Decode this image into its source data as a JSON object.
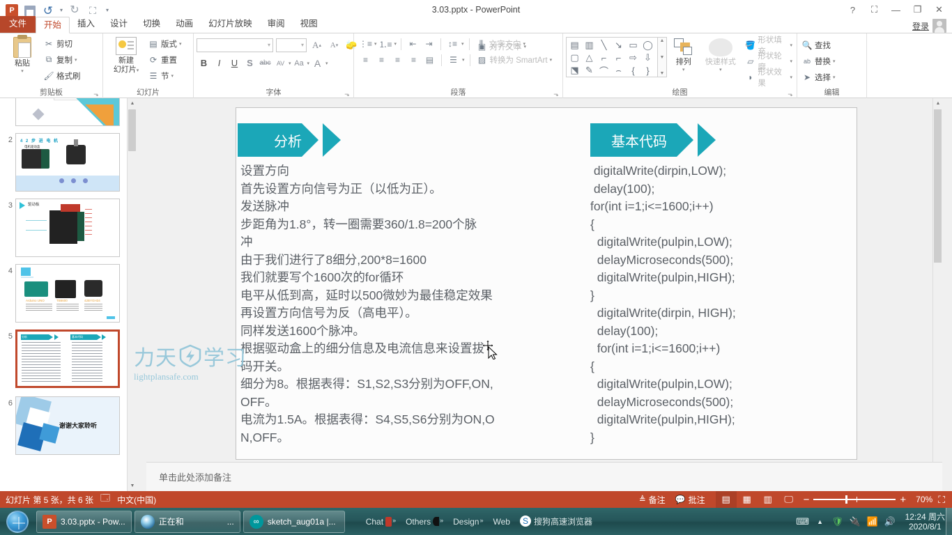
{
  "titlebar": {
    "app_icon": "powerpoint-icon",
    "title": "3.03.pptx - PowerPoint",
    "qat": [
      {
        "name": "save",
        "icon": "save-icon"
      },
      {
        "name": "undo",
        "icon": "undo-icon"
      },
      {
        "name": "redo",
        "icon": "redo-icon"
      },
      {
        "name": "start-slideshow",
        "icon": "slideshow-icon"
      },
      {
        "name": "customize-qat",
        "icon": "chevron-down-icon"
      }
    ],
    "help": "?",
    "ribbon_display": "⛶",
    "minimize": "—",
    "restore": "❐",
    "close": "✕",
    "signin": "登录"
  },
  "tabs": [
    {
      "label": "文件",
      "active": false,
      "file": true
    },
    {
      "label": "开始",
      "active": true
    },
    {
      "label": "插入",
      "active": false
    },
    {
      "label": "设计",
      "active": false
    },
    {
      "label": "切换",
      "active": false
    },
    {
      "label": "动画",
      "active": false
    },
    {
      "label": "幻灯片放映",
      "active": false
    },
    {
      "label": "审阅",
      "active": false
    },
    {
      "label": "视图",
      "active": false
    }
  ],
  "ribbon": {
    "groups": [
      {
        "name": "clipboard",
        "label": "剪贴板",
        "big": {
          "label1": "粘贴",
          "label2": ""
        },
        "items": [
          {
            "label": "剪切",
            "icon": "scissors-icon"
          },
          {
            "label": "复制",
            "icon": "copy-icon"
          },
          {
            "label": "格式刷",
            "icon": "format-painter-icon"
          }
        ]
      },
      {
        "name": "slides",
        "label": "幻灯片",
        "big": {
          "label1": "新建",
          "label2": "幻灯片"
        },
        "items": [
          {
            "label": "版式",
            "icon": "layout-icon"
          },
          {
            "label": "重置",
            "icon": "reset-icon"
          },
          {
            "label": "节",
            "icon": "section-icon"
          }
        ]
      },
      {
        "name": "font",
        "label": "字体",
        "font_name": "",
        "font_size": "",
        "buttons": [
          "B",
          "I",
          "U",
          "S",
          "abc",
          "AV",
          "Aa",
          "A"
        ]
      },
      {
        "name": "paragraph",
        "label": "段落",
        "items": [
          {
            "label": "文字方向",
            "icon": "text-direction-icon"
          },
          {
            "label": "对齐文本",
            "icon": "align-text-icon"
          },
          {
            "label": "转换为 SmartArt",
            "icon": "smartart-icon"
          }
        ]
      },
      {
        "name": "drawing",
        "label": "绘图",
        "arrange": "排列",
        "quickstyles": "快速样式",
        "items": [
          {
            "label": "形状填充",
            "icon": "shape-fill-icon"
          },
          {
            "label": "形状轮廓",
            "icon": "shape-outline-icon"
          },
          {
            "label": "形状效果",
            "icon": "shape-effects-icon"
          }
        ]
      },
      {
        "name": "editing",
        "label": "编辑",
        "items": [
          {
            "label": "查找",
            "icon": "find-icon"
          },
          {
            "label": "替换",
            "icon": "replace-icon"
          },
          {
            "label": "选择",
            "icon": "select-icon"
          }
        ]
      }
    ]
  },
  "thumbnails": [
    {
      "number": "1",
      "selected": false
    },
    {
      "number": "2",
      "selected": false,
      "title": "4 2 步 进 电 机",
      "caption": "电机驱动盒"
    },
    {
      "number": "3",
      "selected": false,
      "title": "驱动板"
    },
    {
      "number": "4",
      "selected": false,
      "labels": [
        "Arduino UNO",
        "TB6600",
        "42BYGH34"
      ]
    },
    {
      "number": "5",
      "selected": true,
      "heading_left": "分析",
      "heading_right": "基本代码"
    },
    {
      "number": "6",
      "selected": false,
      "title": "谢谢大家聆听"
    }
  ],
  "slide": {
    "left_heading": "分析",
    "right_heading": "基本代码",
    "left_body": "设置方向\n首先设置方向信号为正（以低为正）。\n发送脉冲\n步距角为1.8°，转一圈需要360/1.8=200个脉\n冲\n由于我们进行了8细分,200*8=1600\n我们就要写个1600次的for循环\n电平从低到高，延时以500微妙为最佳稳定效果\n再设置方向信号为反（高电平）。\n同样发送1600个脉冲。\n根据驱动盒上的细分信息及电流信息来设置拔\n码开关。\n细分为8。根据表得：S1,S2,S3分别为OFF,ON,\nOFF。\n电流为1.5A。根据表得：S4,S5,S6分别为ON,O\nN,OFF。",
    "right_body": " digitalWrite(dirpin,LOW);\n delay(100);\nfor(int i=1;i<=1600;i++)\n{\n  digitalWrite(pulpin,LOW);\n  delayMicroseconds(500);\n  digitalWrite(pulpin,HIGH);\n}\n  digitalWrite(dirpin, HIGH);\n  delay(100);\n  for(int i=1;i<=1600;i++)\n{\n  digitalWrite(pulpin,LOW);\n  delayMicroseconds(500);\n  digitalWrite(pulpin,HIGH);\n}",
    "accent_color": "#1ba7b8",
    "watermark_cn": "力天 学习",
    "watermark_en": "lightplansafe.com"
  },
  "notes": {
    "placeholder": "单击此处添加备注"
  },
  "statusbar": {
    "slide_info": "幻灯片 第 5 张，共 6 张",
    "language": "中文(中国)",
    "notes_label": "备注",
    "comments_label": "批注",
    "views": [
      {
        "name": "normal-view",
        "icon": "normal-view-icon",
        "active": true
      },
      {
        "name": "slide-sorter-view",
        "icon": "sorter-view-icon",
        "active": false
      },
      {
        "name": "reading-view",
        "icon": "reading-view-icon",
        "active": false
      },
      {
        "name": "slideshow-view",
        "icon": "slideshow-view-icon",
        "active": false
      }
    ],
    "zoom_out": "−",
    "zoom_in": "+",
    "zoom_level": "70%",
    "fit_label": "fit-to-window-icon",
    "bg_color": "#c0482b"
  },
  "taskbar": {
    "start": "start-orb",
    "items": [
      {
        "label": "3.03.pptx - Pow...",
        "icon": "powerpoint-icon"
      },
      {
        "label": "正在和",
        "trailing": "...",
        "icon": "camera-icon"
      },
      {
        "label": "sketch_aug01a |...",
        "icon": "arduino-icon"
      }
    ],
    "deskbands": [
      {
        "label": "Chat",
        "chev": "»"
      },
      {
        "label": "Others",
        "chev": "»"
      },
      {
        "label": "Design",
        "chev": "»"
      },
      {
        "label": "Web",
        "chev": ""
      }
    ],
    "browser_label": "搜狗高速浏览器",
    "tray_icons": [
      "keyboard-icon",
      "show-hidden-icon",
      "shield-icon",
      "network-plug-icon",
      "signal-icon",
      "volume-icon"
    ],
    "clock_time": "12:24 周六",
    "clock_date": "2020/8/1"
  }
}
